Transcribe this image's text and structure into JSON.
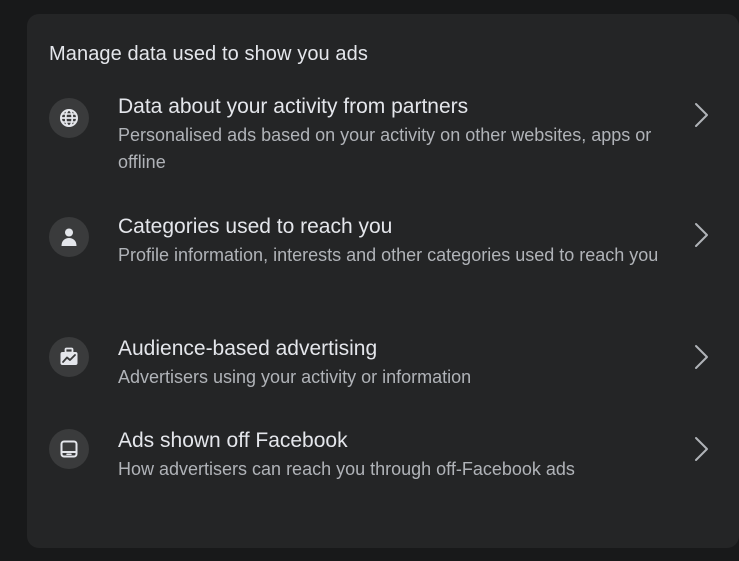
{
  "section": {
    "title": "Manage data used to show you ads"
  },
  "items": [
    {
      "icon": "globe-icon",
      "title": "Data about your activity from partners",
      "description": "Personalised ads based on your activity on other websites, apps or offline"
    },
    {
      "icon": "person-icon",
      "title": "Categories used to reach you",
      "description": "Profile information, interests and other categories used to reach you"
    },
    {
      "icon": "briefcase-chart-icon",
      "title": "Audience-based advertising",
      "description": "Advertisers using your activity or information"
    },
    {
      "icon": "device-icon",
      "title": "Ads shown off Facebook",
      "description": "How advertisers can reach you through off-Facebook ads"
    }
  ],
  "colors": {
    "page_background": "#18191a",
    "card_background": "#242526",
    "icon_circle": "#3a3b3c",
    "primary_text": "#e4e6eb",
    "secondary_text": "#b0b3b8"
  }
}
